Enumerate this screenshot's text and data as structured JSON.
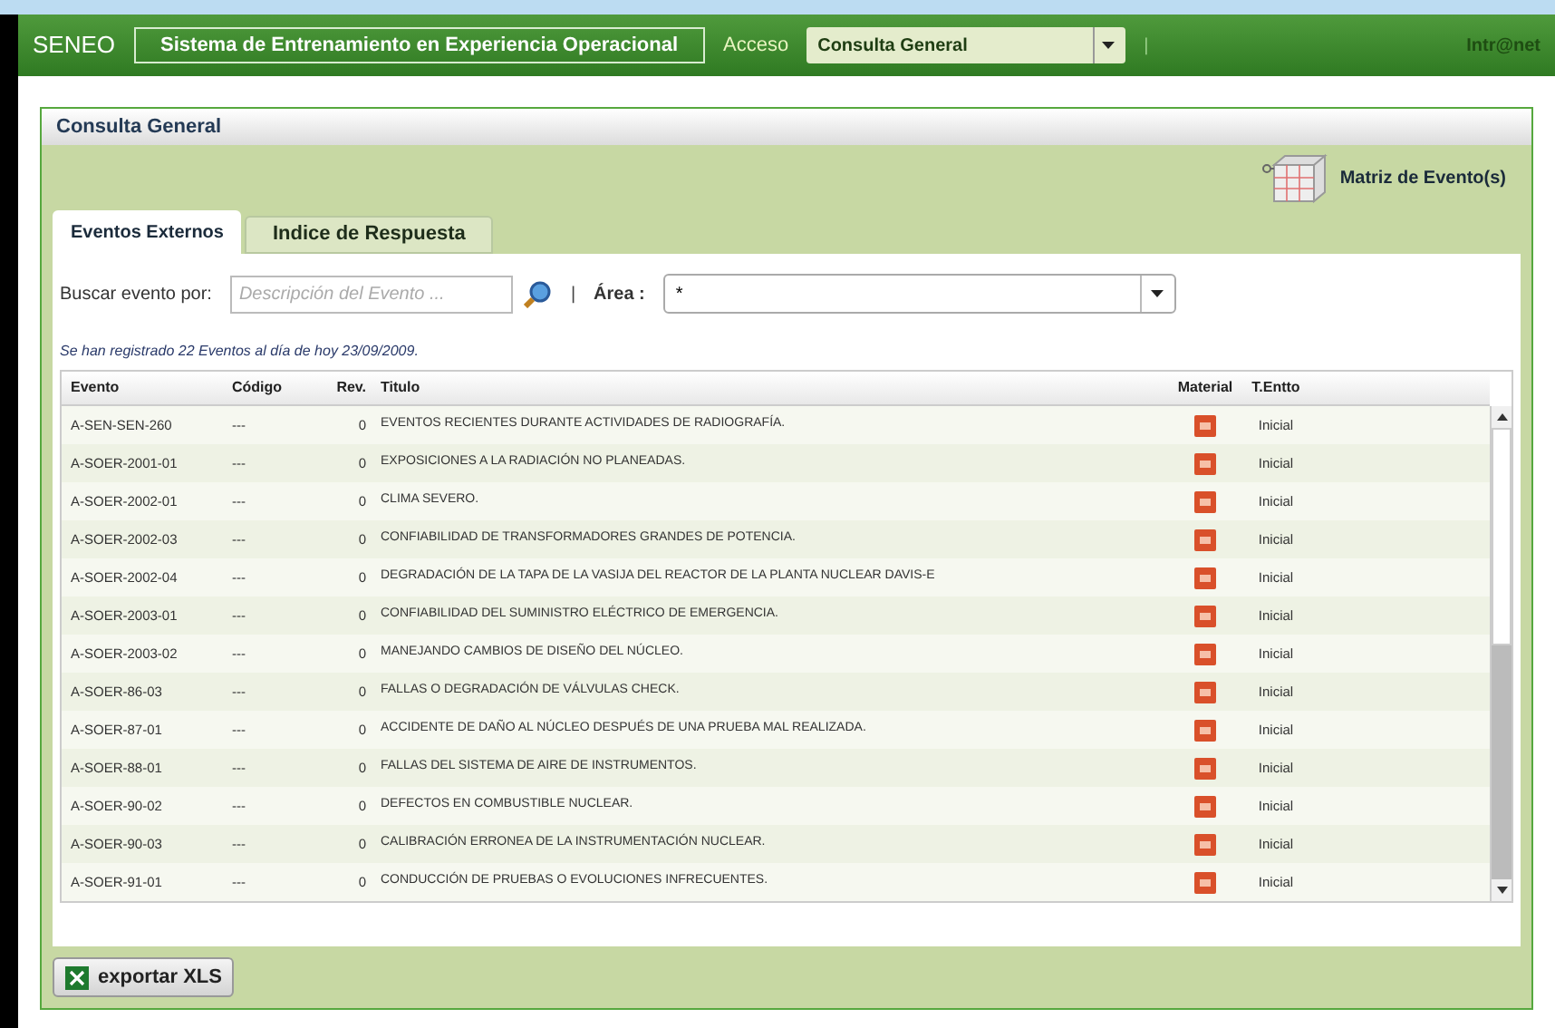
{
  "header": {
    "brand": "SENEO",
    "system_title": "Sistema de Entrenamiento en Experiencia Operacional",
    "access_label": "Acceso",
    "access_select": "Consulta General",
    "separator": "|",
    "link": "Intr@net"
  },
  "panel": {
    "title": "Consulta General",
    "matrix_link": "Matriz de Evento(s)"
  },
  "tabs": [
    {
      "label": "Eventos Externos",
      "selected": true
    },
    {
      "label": "Indice de Respuesta",
      "selected": false
    }
  ],
  "search": {
    "label": "Buscar evento por:",
    "placeholder": "Descripción del Evento ...",
    "separator": "|",
    "area_label": "Área :",
    "area_value": "*"
  },
  "summary": "Se han registrado 22 Eventos al día de hoy 23/09/2009.",
  "table": {
    "columns": [
      "Evento",
      "Código",
      "Rev.",
      "Titulo",
      "Material",
      "T.Entto"
    ],
    "rows": [
      {
        "evento": "A-SEN-SEN-260",
        "codigo": "---",
        "rev": "0",
        "titulo": "EVENTOS RECIENTES DURANTE ACTIVIDADES DE RADIOGRAFÍA.",
        "tipo": "Inicial"
      },
      {
        "evento": "A-SOER-2001-01",
        "codigo": "---",
        "rev": "0",
        "titulo": "EXPOSICIONES A LA RADIACIÓN NO PLANEADAS.",
        "tipo": "Inicial"
      },
      {
        "evento": "A-SOER-2002-01",
        "codigo": "---",
        "rev": "0",
        "titulo": "CLIMA SEVERO.",
        "tipo": "Inicial"
      },
      {
        "evento": "A-SOER-2002-03",
        "codigo": "---",
        "rev": "0",
        "titulo": "CONFIABILIDAD DE TRANSFORMADORES GRANDES DE POTENCIA.",
        "tipo": "Inicial"
      },
      {
        "evento": "A-SOER-2002-04",
        "codigo": "---",
        "rev": "0",
        "titulo": "DEGRADACIÓN DE LA TAPA DE LA VASIJA DEL REACTOR DE LA PLANTA NUCLEAR DAVIS-E",
        "tipo": "Inicial"
      },
      {
        "evento": "A-SOER-2003-01",
        "codigo": "---",
        "rev": "0",
        "titulo": "CONFIABILIDAD DEL SUMINISTRO ELÉCTRICO DE EMERGENCIA.",
        "tipo": "Inicial"
      },
      {
        "evento": "A-SOER-2003-02",
        "codigo": "---",
        "rev": "0",
        "titulo": "MANEJANDO CAMBIOS DE DISEÑO DEL NÚCLEO.",
        "tipo": "Inicial"
      },
      {
        "evento": "A-SOER-86-03",
        "codigo": "---",
        "rev": "0",
        "titulo": "FALLAS O DEGRADACIÓN DE VÁLVULAS CHECK.",
        "tipo": "Inicial"
      },
      {
        "evento": "A-SOER-87-01",
        "codigo": "---",
        "rev": "0",
        "titulo": "ACCIDENTE DE DAÑO AL NÚCLEO DESPUÉS DE UNA PRUEBA MAL REALIZADA.",
        "tipo": "Inicial"
      },
      {
        "evento": "A-SOER-88-01",
        "codigo": "---",
        "rev": "0",
        "titulo": "FALLAS DEL SISTEMA DE AIRE DE INSTRUMENTOS.",
        "tipo": "Inicial"
      },
      {
        "evento": "A-SOER-90-02",
        "codigo": "---",
        "rev": "0",
        "titulo": "DEFECTOS EN COMBUSTIBLE NUCLEAR.",
        "tipo": "Inicial"
      },
      {
        "evento": "A-SOER-90-03",
        "codigo": "---",
        "rev": "0",
        "titulo": "CALIBRACIÓN ERRONEA DE LA INSTRUMENTACIÓN NUCLEAR.",
        "tipo": "Inicial"
      },
      {
        "evento": "A-SOER-91-01",
        "codigo": "---",
        "rev": "0",
        "titulo": "CONDUCCIÓN DE PRUEBAS O EVOLUCIONES INFRECUENTES.",
        "tipo": "Inicial"
      }
    ]
  },
  "export_button": "exportar XLS"
}
